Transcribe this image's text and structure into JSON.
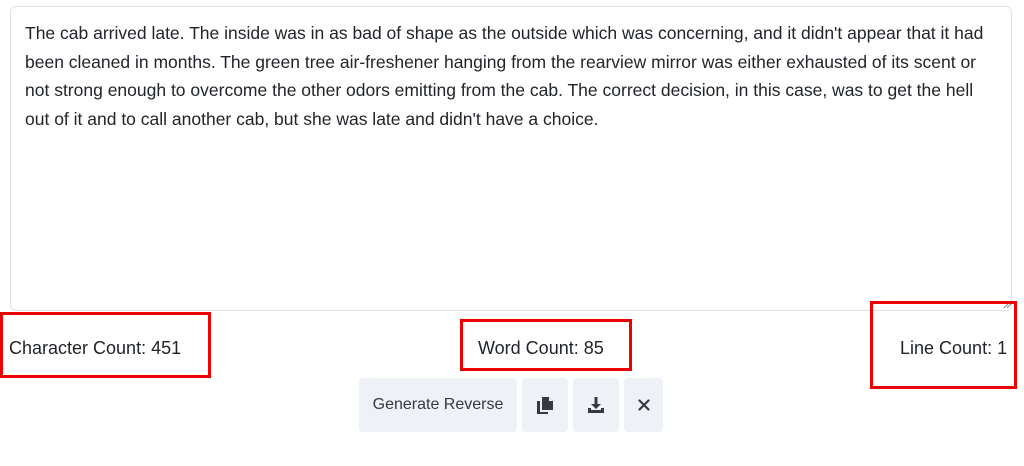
{
  "editor": {
    "text": "The cab arrived late. The inside was in as bad of shape as the outside which was concerning, and it didn't appear that it had been cleaned in months. The green tree air-freshener hanging from the rearview mirror was either exhausted of its scent or not strong enough to overcome the other odors emitting from the cab. The correct decision, in this case, was to get the hell out of it and to call another cab, but she was late and didn't have a choice."
  },
  "stats": {
    "character_count": "Character Count: 451",
    "word_count": "Word Count: 85",
    "line_count": "Line Count: 1"
  },
  "actions": {
    "generate_label": "Generate Reverse",
    "copy_icon": "copy-icon",
    "download_icon": "download-icon",
    "clear_icon": "close-icon"
  },
  "colors": {
    "highlight_border": "#ee0000",
    "button_bg": "#eef1f6"
  }
}
